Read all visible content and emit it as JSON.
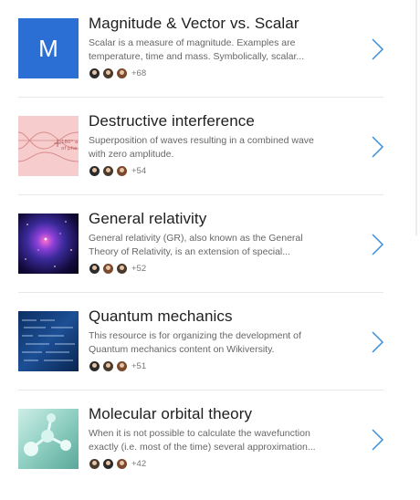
{
  "items": [
    {
      "title": "Magnitude & Vector vs. Scalar",
      "description": "Scalar is a measure of magnitude. Examples are temperature, time and mass. Symbolically, scalar...",
      "count": "+68",
      "thumb_letter": "M",
      "thumb_icon": "letter-tile"
    },
    {
      "title": "Destructive interference",
      "description": "Superposition of waves resulting in a combined wave with zero amplitude.",
      "count": "+54",
      "thumb_icon": "wave-diagram",
      "thumb_text": [
        "180° a",
        "of pha"
      ]
    },
    {
      "title": "General relativity",
      "description": "General relativity (GR), also known as the General Theory of Relativity, is an extension of special...",
      "count": "+52",
      "thumb_icon": "galaxy-image"
    },
    {
      "title": "Quantum mechanics",
      "description": "This resource is for organizing the development of Quantum mechanics content on Wikiversity.",
      "count": "+51",
      "thumb_icon": "equations-image"
    },
    {
      "title": "Molecular orbital theory",
      "description": "When it is not possible to calculate the wavefunction exactly (i.e. most of the time) several approximation...",
      "count": "+42",
      "thumb_icon": "molecule-image"
    }
  ],
  "colors": {
    "accent": "#2b6fd4",
    "chevron": "#3b8fd8"
  }
}
